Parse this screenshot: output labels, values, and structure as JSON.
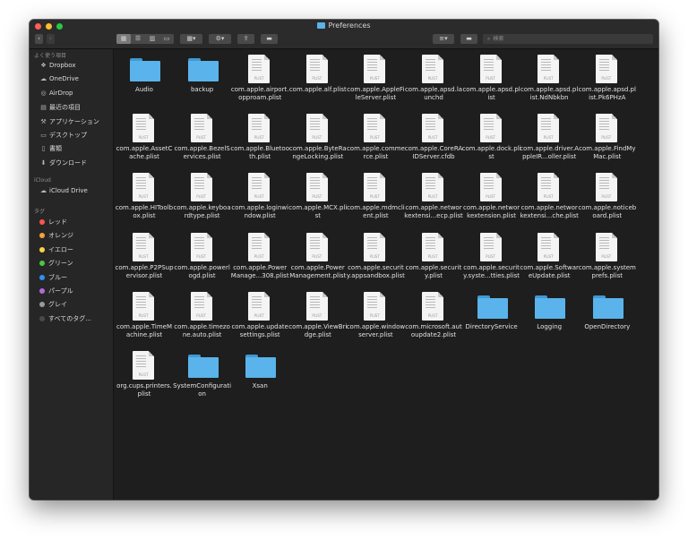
{
  "window": {
    "title": "Preferences"
  },
  "toolbar": {
    "back_icon": "chevron-left-icon",
    "forward_icon": "chevron-right-icon",
    "search_placeholder": "検索"
  },
  "sidebar": {
    "favorites_header": "よく使う項目",
    "favorites": [
      {
        "label": "Dropbox",
        "icon": "dropbox-icon"
      },
      {
        "label": "OneDrive",
        "icon": "cloud-icon"
      },
      {
        "label": "AirDrop",
        "icon": "airdrop-icon"
      },
      {
        "label": "最近の項目",
        "icon": "recents-icon"
      },
      {
        "label": "アプリケーション",
        "icon": "applications-icon"
      },
      {
        "label": "デスクトップ",
        "icon": "desktop-icon"
      },
      {
        "label": "書類",
        "icon": "document-icon"
      },
      {
        "label": "ダウンロード",
        "icon": "download-icon"
      }
    ],
    "icloud_header": "iCloud",
    "icloud": [
      {
        "label": "iCloud Drive",
        "icon": "cloud-icon"
      }
    ],
    "tags_header": "タグ",
    "tags": [
      {
        "label": "レッド",
        "color": "#ff5257"
      },
      {
        "label": "オレンジ",
        "color": "#f7a23b"
      },
      {
        "label": "イエロー",
        "color": "#fbd33f"
      },
      {
        "label": "グリーン",
        "color": "#49c93f"
      },
      {
        "label": "ブルー",
        "color": "#2f8ff5"
      },
      {
        "label": "パープル",
        "color": "#b569d9"
      },
      {
        "label": "グレイ",
        "color": "#9a9a9a"
      },
      {
        "label": "すべてのタグ...",
        "color": "#4a4a4a"
      }
    ]
  },
  "files": [
    {
      "name": "Audio",
      "type": "folder"
    },
    {
      "name": "backup",
      "type": "folder"
    },
    {
      "name": "com.apple.airport.opproam.plist",
      "type": "plist"
    },
    {
      "name": "com.apple.alf.plist",
      "type": "plist"
    },
    {
      "name": "com.apple.AppleFileServer.plist",
      "type": "plist"
    },
    {
      "name": "com.apple.apsd.launchd",
      "type": "plist"
    },
    {
      "name": "com.apple.apsd.plist",
      "type": "plist"
    },
    {
      "name": "com.apple.apsd.plist.NdNbkbn",
      "type": "plist"
    },
    {
      "name": "com.apple.apsd.plist.Pk6PHzA",
      "type": "plist"
    },
    {
      "name": "com.apple.AssetCache.plist",
      "type": "plist"
    },
    {
      "name": "com.apple.BezelServices.plist",
      "type": "plist"
    },
    {
      "name": "com.apple.Bluetooth.plist",
      "type": "plist"
    },
    {
      "name": "com.apple.ByteRangeLocking.plist",
      "type": "plist"
    },
    {
      "name": "com.apple.commerce.plist",
      "type": "plist"
    },
    {
      "name": "com.apple.CoreRAIDServer.cfdb",
      "type": "plist"
    },
    {
      "name": "com.apple.dock.plist",
      "type": "plist"
    },
    {
      "name": "com.apple.driver.AppleIR...oller.plist",
      "type": "plist"
    },
    {
      "name": "com.apple.FindMyMac.plist",
      "type": "plist"
    },
    {
      "name": "com.apple.HIToolbox.plist",
      "type": "plist"
    },
    {
      "name": "com.apple.keyboardtype.plist",
      "type": "plist"
    },
    {
      "name": "com.apple.loginwindow.plist",
      "type": "plist"
    },
    {
      "name": "com.apple.MCX.plist",
      "type": "plist"
    },
    {
      "name": "com.apple.mdmclient.plist",
      "type": "plist"
    },
    {
      "name": "com.apple.networkextensi...ecp.plist",
      "type": "plist"
    },
    {
      "name": "com.apple.networkextension.plist",
      "type": "plist"
    },
    {
      "name": "com.apple.networkextensi...che.plist",
      "type": "plist"
    },
    {
      "name": "com.apple.noticeboard.plist",
      "type": "plist"
    },
    {
      "name": "com.apple.P2PSupervisor.plist",
      "type": "plist"
    },
    {
      "name": "com.apple.powerlogd.plist",
      "type": "plist"
    },
    {
      "name": "com.apple.PowerManage...308.plist",
      "type": "plist"
    },
    {
      "name": "com.apple.PowerManagement.plist",
      "type": "plist"
    },
    {
      "name": "com.apple.security.appsandbox.plist",
      "type": "plist"
    },
    {
      "name": "com.apple.security.plist",
      "type": "plist"
    },
    {
      "name": "com.apple.security.syste...tties.plist",
      "type": "plist"
    },
    {
      "name": "com.apple.SoftwareUpdate.plist",
      "type": "plist"
    },
    {
      "name": "com.apple.systemprefs.plist",
      "type": "plist"
    },
    {
      "name": "com.apple.TimeMachine.plist",
      "type": "plist"
    },
    {
      "name": "com.apple.timezone.auto.plist",
      "type": "plist"
    },
    {
      "name": "com.apple.updatesettings.plist",
      "type": "plist"
    },
    {
      "name": "com.apple.ViewBridge.plist",
      "type": "plist"
    },
    {
      "name": "com.apple.windowserver.plist",
      "type": "plist"
    },
    {
      "name": "com.microsoft.autoupdate2.plist",
      "type": "plist"
    },
    {
      "name": "DirectoryService",
      "type": "folder"
    },
    {
      "name": "Logging",
      "type": "folder"
    },
    {
      "name": "OpenDirectory",
      "type": "folder"
    },
    {
      "name": "org.cups.printers.plist",
      "type": "plist"
    },
    {
      "name": "SystemConfiguration",
      "type": "folder"
    },
    {
      "name": "Xsan",
      "type": "folder"
    }
  ]
}
